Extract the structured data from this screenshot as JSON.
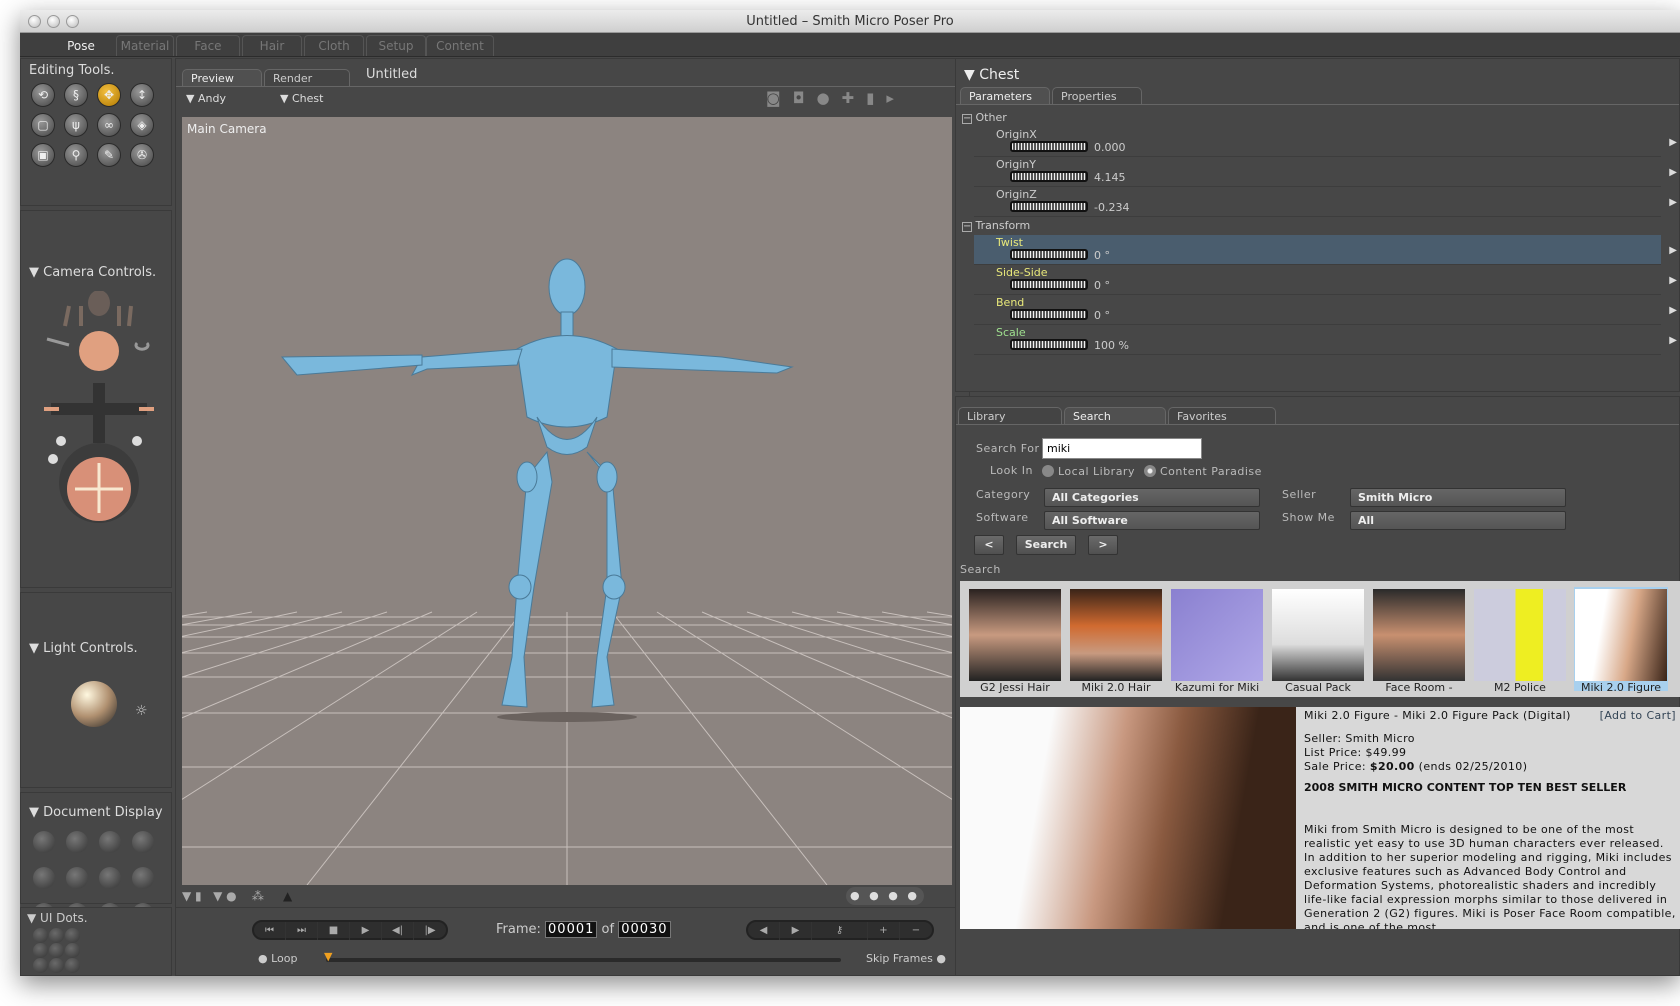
{
  "window": {
    "title": "Untitled – Smith Micro Poser Pro"
  },
  "rooms": [
    {
      "label": "Pose",
      "active": true
    },
    {
      "label": "Material"
    },
    {
      "label": "Face"
    },
    {
      "label": "Hair"
    },
    {
      "label": "Cloth"
    },
    {
      "label": "Setup"
    },
    {
      "label": "Content"
    }
  ],
  "left": {
    "editing_tools": "Editing Tools.",
    "tools": [
      "rotate-icon",
      "twist-icon",
      "translate-icon",
      "translate-in-out-icon",
      "scale-icon",
      "taper-icon",
      "chain-break-icon",
      "color-icon",
      "grouping-icon",
      "view-magnifier-icon",
      "morphing-tool-icon",
      "direct-manipulation-icon"
    ],
    "camera_controls": "Camera Controls.",
    "light_controls": "Light Controls.",
    "document_display": "Document Display",
    "ui_dots": "UI Dots."
  },
  "viewport": {
    "tabs": [
      "Preview",
      "Render"
    ],
    "doc_title": "Untitled",
    "figure_menu": "Andy",
    "actor_menu": "Chest",
    "camera_label": "Main Camera",
    "background_color": "#8c8480",
    "figure_color": "#7ab8dc"
  },
  "timeline": {
    "frame_label": "Frame:",
    "frame": "00001",
    "of_label": "of",
    "total": "00030",
    "loop_label": "Loop",
    "skip_frames_label": "Skip Frames"
  },
  "params": {
    "title": "Chest",
    "tabs": [
      "Parameters",
      "Properties"
    ],
    "groups": [
      {
        "name": "Other",
        "items": [
          {
            "name": "OriginX",
            "value": "0.000"
          },
          {
            "name": "OriginY",
            "value": "4.145"
          },
          {
            "name": "OriginZ",
            "value": "-0.234"
          }
        ]
      },
      {
        "name": "Transform",
        "items": [
          {
            "name": "Twist",
            "value": "0 °",
            "selected": true
          },
          {
            "name": "Side-Side",
            "value": "0 °"
          },
          {
            "name": "Bend",
            "value": "0 °"
          },
          {
            "name": "Scale",
            "value": "100 %"
          }
        ]
      }
    ]
  },
  "library": {
    "tabs": [
      "Library",
      "Search",
      "Favorites"
    ],
    "search_for_label": "Search For",
    "search_value": "miki",
    "look_in_label": "Look In",
    "look_in_options": [
      "Local Library",
      "Content Paradise"
    ],
    "look_in_selected": "Content Paradise",
    "category_label": "Category",
    "category_value": "All Categories",
    "software_label": "Software",
    "software_value": "All Software",
    "seller_label": "Seller",
    "seller_value": "Smith Micro",
    "show_me_label": "Show Me",
    "show_me_value": "All",
    "prev_label": "<",
    "search_button": "Search",
    "next_label": ">",
    "results_label": "Search",
    "results": [
      {
        "label": "G2 Jessi Hair"
      },
      {
        "label": "Miki 2.0 Hair"
      },
      {
        "label": "Kazumi for Miki"
      },
      {
        "label": "Casual Pack"
      },
      {
        "label": "Face Room -"
      },
      {
        "label": "M2 Police"
      },
      {
        "label": "Miki 2.0 Figure",
        "selected": true
      }
    ],
    "detail": {
      "title": "Miki 2.0 Figure - Miki 2.0 Figure Pack (Digital)",
      "add_to_cart": "[Add to Cart]",
      "seller": "Seller: Smith Micro",
      "list_price": "List Price: $49.99",
      "sale_label": "Sale Price: ",
      "sale_price": "$20.00",
      "sale_ends": " (ends 02/25/2010)",
      "headline": "2008 SMITH MICRO CONTENT TOP TEN BEST SELLER",
      "description": "Miki from Smith Micro is designed to be one of the most realistic yet easy to use 3D human characters ever released. In addition to her superior modeling and rigging, Miki includes exclusive features such as Advanced Body Control and Deformation Systems, photorealistic shaders and incredibly life-like facial expression morphs similar to those delivered in Generation 2 (G2) figures. Miki is Poser Face Room compatible, and is one of the most"
    }
  }
}
